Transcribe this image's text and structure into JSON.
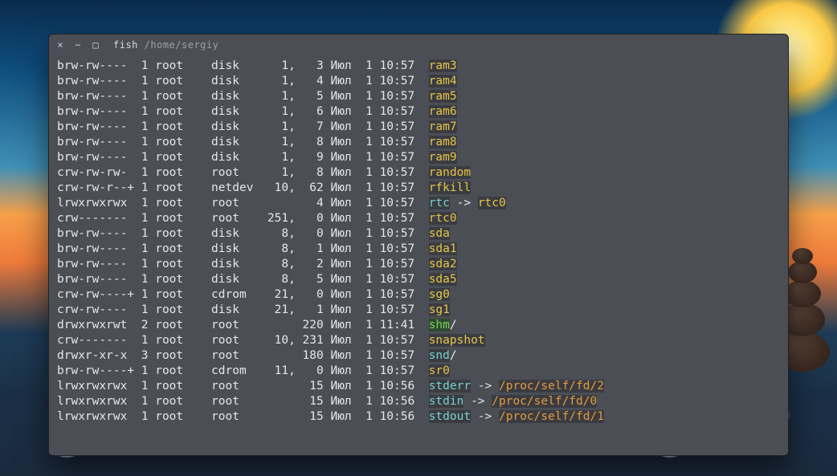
{
  "window": {
    "close_glyph": "×",
    "min_glyph": "−",
    "max_glyph": "□",
    "title_app": "fish",
    "title_path": "/home/sergiy"
  },
  "listing": [
    {
      "perm": "brw-rw----",
      "links": "1",
      "owner": "root",
      "group": "disk",
      "maj": "1,",
      "min": "3",
      "month": "Июл",
      "day": "1",
      "time": "10:57",
      "name": "ram3",
      "cls": "c-yellow"
    },
    {
      "perm": "brw-rw----",
      "links": "1",
      "owner": "root",
      "group": "disk",
      "maj": "1,",
      "min": "4",
      "month": "Июл",
      "day": "1",
      "time": "10:57",
      "name": "ram4",
      "cls": "c-yellow"
    },
    {
      "perm": "brw-rw----",
      "links": "1",
      "owner": "root",
      "group": "disk",
      "maj": "1,",
      "min": "5",
      "month": "Июл",
      "day": "1",
      "time": "10:57",
      "name": "ram5",
      "cls": "c-yellow"
    },
    {
      "perm": "brw-rw----",
      "links": "1",
      "owner": "root",
      "group": "disk",
      "maj": "1,",
      "min": "6",
      "month": "Июл",
      "day": "1",
      "time": "10:57",
      "name": "ram6",
      "cls": "c-yellow"
    },
    {
      "perm": "brw-rw----",
      "links": "1",
      "owner": "root",
      "group": "disk",
      "maj": "1,",
      "min": "7",
      "month": "Июл",
      "day": "1",
      "time": "10:57",
      "name": "ram7",
      "cls": "c-yellow"
    },
    {
      "perm": "brw-rw----",
      "links": "1",
      "owner": "root",
      "group": "disk",
      "maj": "1,",
      "min": "8",
      "month": "Июл",
      "day": "1",
      "time": "10:57",
      "name": "ram8",
      "cls": "c-yellow"
    },
    {
      "perm": "brw-rw----",
      "links": "1",
      "owner": "root",
      "group": "disk",
      "maj": "1,",
      "min": "9",
      "month": "Июл",
      "day": "1",
      "time": "10:57",
      "name": "ram9",
      "cls": "c-yellow"
    },
    {
      "perm": "crw-rw-rw-",
      "links": "1",
      "owner": "root",
      "group": "root",
      "maj": "1,",
      "min": "8",
      "month": "Июл",
      "day": "1",
      "time": "10:57",
      "name": "random",
      "cls": "c-yellow"
    },
    {
      "perm": "crw-rw-r--+",
      "links": "1",
      "owner": "root",
      "group": "netdev",
      "maj": "10,",
      "min": "62",
      "month": "Июл",
      "day": "1",
      "time": "10:57",
      "name": "rfkill",
      "cls": "c-yellow"
    },
    {
      "perm": "lrwxrwxrwx",
      "links": "1",
      "owner": "root",
      "group": "root",
      "maj": "",
      "min": "4",
      "month": "Июл",
      "day": "1",
      "time": "10:57",
      "name": "rtc",
      "cls": "c-cyan",
      "link_to": "rtc0",
      "link_cls": "c-yellow"
    },
    {
      "perm": "crw-------",
      "links": "1",
      "owner": "root",
      "group": "root",
      "maj": "251,",
      "min": "0",
      "month": "Июл",
      "day": "1",
      "time": "10:57",
      "name": "rtc0",
      "cls": "c-yellow"
    },
    {
      "perm": "brw-rw----",
      "links": "1",
      "owner": "root",
      "group": "disk",
      "maj": "8,",
      "min": "0",
      "month": "Июл",
      "day": "1",
      "time": "10:57",
      "name": "sda",
      "cls": "c-yellow"
    },
    {
      "perm": "brw-rw----",
      "links": "1",
      "owner": "root",
      "group": "disk",
      "maj": "8,",
      "min": "1",
      "month": "Июл",
      "day": "1",
      "time": "10:57",
      "name": "sda1",
      "cls": "c-yellow"
    },
    {
      "perm": "brw-rw----",
      "links": "1",
      "owner": "root",
      "group": "disk",
      "maj": "8,",
      "min": "2",
      "month": "Июл",
      "day": "1",
      "time": "10:57",
      "name": "sda2",
      "cls": "c-yellow"
    },
    {
      "perm": "brw-rw----",
      "links": "1",
      "owner": "root",
      "group": "disk",
      "maj": "8,",
      "min": "5",
      "month": "Июл",
      "day": "1",
      "time": "10:57",
      "name": "sda5",
      "cls": "c-yellow"
    },
    {
      "perm": "crw-rw----+",
      "links": "1",
      "owner": "root",
      "group": "cdrom",
      "maj": "21,",
      "min": "0",
      "month": "Июл",
      "day": "1",
      "time": "10:57",
      "name": "sg0",
      "cls": "c-yellow"
    },
    {
      "perm": "crw-rw----",
      "links": "1",
      "owner": "root",
      "group": "disk",
      "maj": "21,",
      "min": "1",
      "month": "Июл",
      "day": "1",
      "time": "10:57",
      "name": "sg1",
      "cls": "c-yellow"
    },
    {
      "perm": "drwxrwxrwt",
      "links": "2",
      "owner": "root",
      "group": "root",
      "maj": "",
      "min": "220",
      "month": "Июл",
      "day": "1",
      "time": "11:41",
      "name": "shm",
      "cls": "c-green",
      "suffix": "/"
    },
    {
      "perm": "crw-------",
      "links": "1",
      "owner": "root",
      "group": "root",
      "maj": "10,",
      "min": "231",
      "month": "Июл",
      "day": "1",
      "time": "10:57",
      "name": "snapshot",
      "cls": "c-yellow"
    },
    {
      "perm": "drwxr-xr-x",
      "links": "3",
      "owner": "root",
      "group": "root",
      "maj": "",
      "min": "180",
      "month": "Июл",
      "day": "1",
      "time": "10:57",
      "name": "snd",
      "cls": "c-cyan",
      "suffix": "/"
    },
    {
      "perm": "brw-rw----+",
      "links": "1",
      "owner": "root",
      "group": "cdrom",
      "maj": "11,",
      "min": "0",
      "month": "Июл",
      "day": "1",
      "time": "10:57",
      "name": "sr0",
      "cls": "c-yellow"
    },
    {
      "perm": "lrwxrwxrwx",
      "links": "1",
      "owner": "root",
      "group": "root",
      "maj": "",
      "min": "15",
      "month": "Июл",
      "day": "1",
      "time": "10:56",
      "name": "stderr",
      "cls": "c-cyan",
      "link_to": "/proc/self/fd/2",
      "link_cls": "c-orange"
    },
    {
      "perm": "lrwxrwxrwx",
      "links": "1",
      "owner": "root",
      "group": "root",
      "maj": "",
      "min": "15",
      "month": "Июл",
      "day": "1",
      "time": "10:56",
      "name": "stdin",
      "cls": "c-cyan",
      "link_to": "/proc/self/fd/0",
      "link_cls": "c-orange"
    },
    {
      "perm": "lrwxrwxrwx",
      "links": "1",
      "owner": "root",
      "group": "root",
      "maj": "",
      "min": "15",
      "month": "Июл",
      "day": "1",
      "time": "10:56",
      "name": "stdout",
      "cls": "c-cyan",
      "link_to": "/proc/self/fd/1",
      "link_cls": "c-orange"
    }
  ]
}
